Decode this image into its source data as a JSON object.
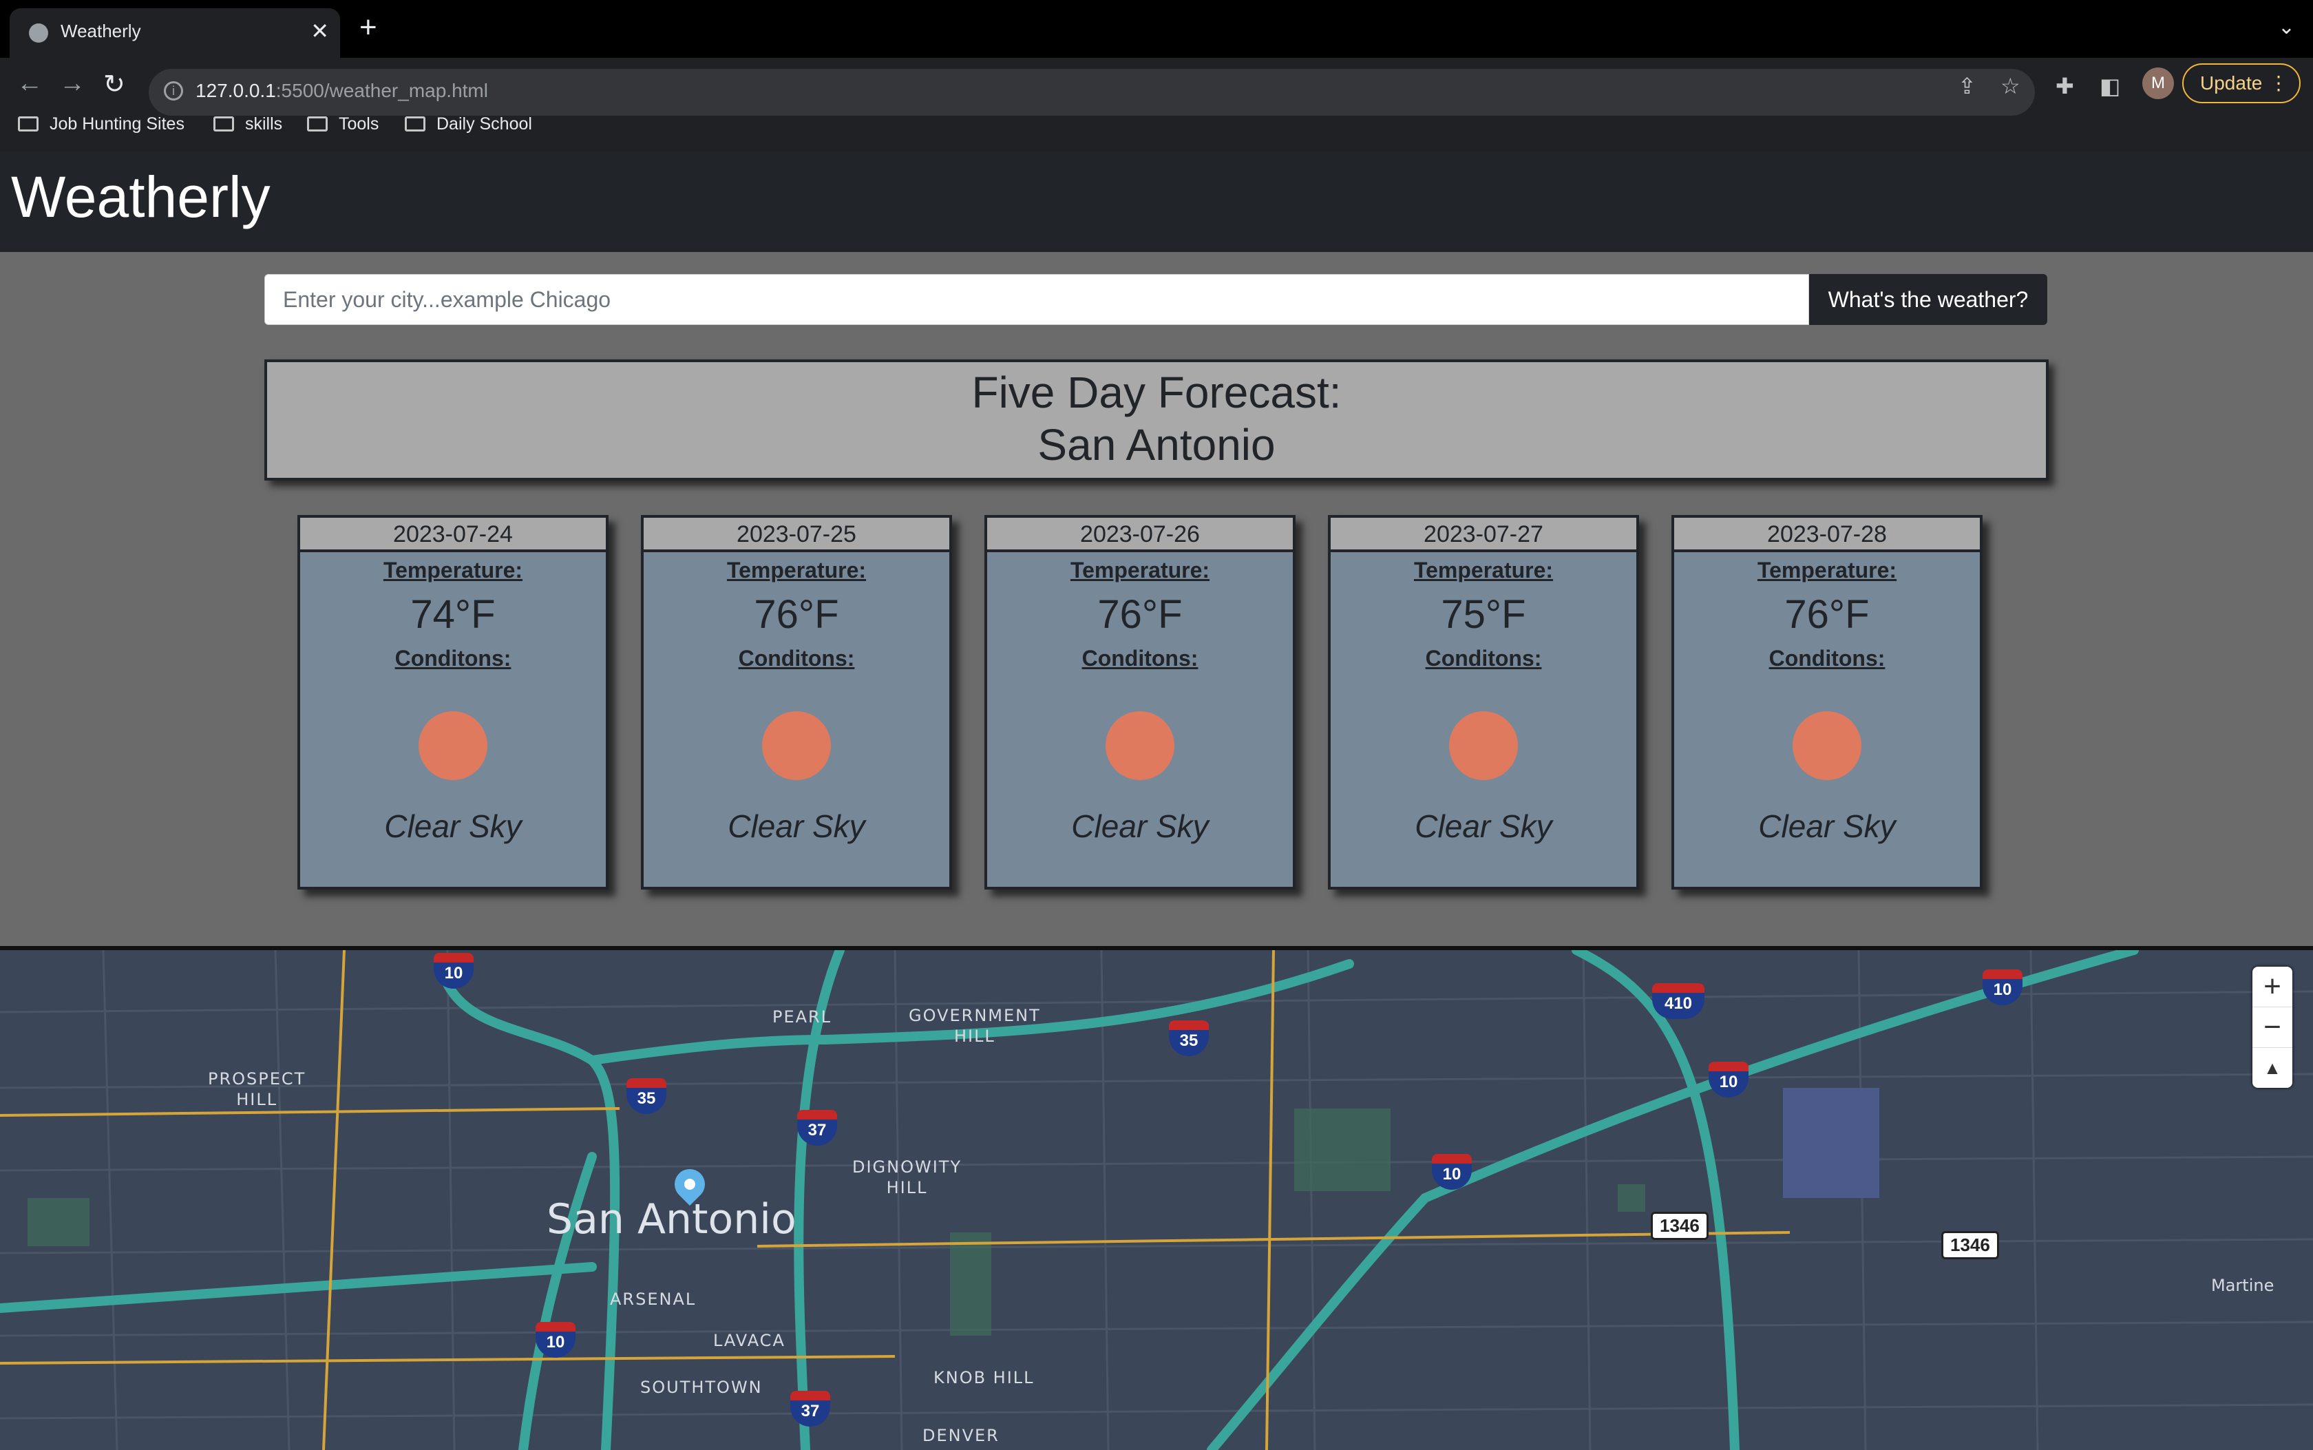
{
  "browser": {
    "tab_title": "Weatherly",
    "new_tab": "+",
    "tab_close": "✕",
    "url_host": "127.0.0.1",
    "url_rest": ":5500/weather_map.html",
    "update_label": "Update",
    "avatar_letter": "M",
    "bookmarks": [
      "Job Hunting Sites",
      "skills",
      "Tools",
      "Daily School"
    ]
  },
  "app": {
    "title": "Weatherly",
    "search_placeholder": "Enter your city...example Chicago",
    "search_button": "What's the weather?",
    "forecast_heading": "Five Day Forecast:",
    "forecast_city": "San Antonio",
    "temperature_label": "Temperature:",
    "conditions_label": "Conditons:",
    "days": [
      {
        "date": "2023-07-24",
        "temp": "74°F",
        "condition": "Clear Sky"
      },
      {
        "date": "2023-07-25",
        "temp": "76°F",
        "condition": "Clear Sky"
      },
      {
        "date": "2023-07-26",
        "temp": "76°F",
        "condition": "Clear Sky"
      },
      {
        "date": "2023-07-27",
        "temp": "75°F",
        "condition": "Clear Sky"
      },
      {
        "date": "2023-07-28",
        "temp": "76°F",
        "condition": "Clear Sky"
      }
    ]
  },
  "map": {
    "city": "San Antonio",
    "neighborhoods": [
      "PEARL",
      "GOVERNMENT",
      "HILL",
      "PROSPECT",
      "HILL",
      "DIGNOWITY",
      "HILL",
      "ARSENAL",
      "LAVACA",
      "SOUTHTOWN",
      "KNOB HILL",
      "DENVER"
    ],
    "edge_label": "Martine",
    "highway_shields": [
      "10",
      "35",
      "37",
      "35",
      "410",
      "10",
      "10",
      "10",
      "10",
      "37"
    ],
    "road_signs": [
      "1346",
      "1346"
    ],
    "zoom_in": "+",
    "zoom_out": "−",
    "compass": "▲"
  }
}
